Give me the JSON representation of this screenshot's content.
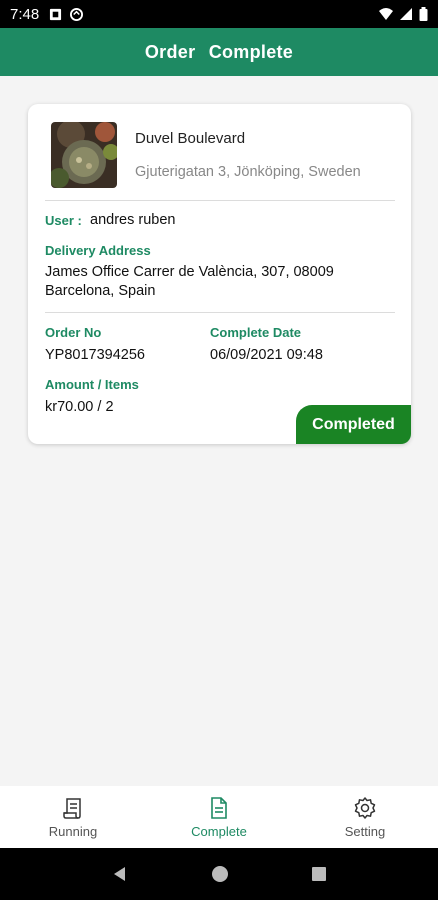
{
  "status_bar": {
    "time": "7:48"
  },
  "app_bar": {
    "title": "Order  Complete"
  },
  "order": {
    "restaurant_name": "Duvel Boulevard",
    "restaurant_address": "Gjuterigatan 3, Jönköping, Sweden",
    "user_label": "User :",
    "user_value": "andres ruben",
    "delivery_label": "Delivery Address",
    "delivery_value": "James Office Carrer de València, 307, 08009 Barcelona, Spain",
    "order_no_label": "Order No",
    "order_no_value": "YP8017394256",
    "complete_date_label": "Complete Date",
    "complete_date_value": "06/09/2021 09:48",
    "amount_label": "Amount / Items",
    "amount_value": "kr70.00 / 2",
    "status_badge": "Completed"
  },
  "bottom_nav": {
    "items": [
      {
        "label": "Running",
        "icon": "receipt-icon"
      },
      {
        "label": "Complete",
        "icon": "document-icon",
        "active": true
      },
      {
        "label": "Setting",
        "icon": "gear-icon"
      }
    ]
  },
  "colors": {
    "primary": "#1e8a63",
    "badge": "#1a8424"
  }
}
